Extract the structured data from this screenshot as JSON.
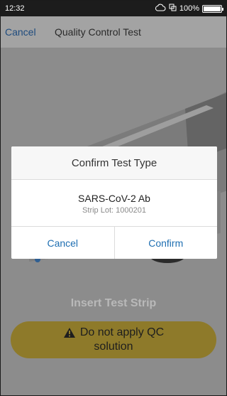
{
  "status_bar": {
    "time": "12:32",
    "battery_text": "100%",
    "battery_level": 1.0
  },
  "nav": {
    "cancel_label": "Cancel",
    "title": "Quality Control Test"
  },
  "dialog": {
    "title": "Confirm Test Type",
    "test_name": "SARS-CoV-2 Ab",
    "strip_lot": "Strip Lot: 1000201",
    "cancel_label": "Cancel",
    "confirm_label": "Confirm"
  },
  "screen": {
    "instruction": "Insert Test Strip",
    "warning_line1": "Do not apply QC",
    "warning_line2": "solution"
  },
  "icons": {
    "cloud": "cloud-icon",
    "sync": "sync-icon",
    "warning": "warning-triangle-icon"
  },
  "colors": {
    "link": "#1f6fb2",
    "warning_bg": "#8e7a2a"
  }
}
